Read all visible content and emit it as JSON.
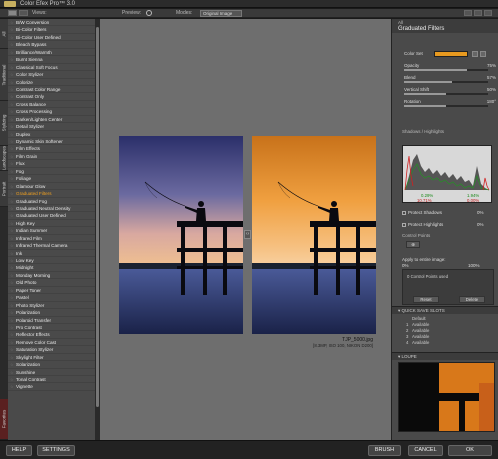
{
  "app": {
    "title": "Color Efex Pro™ 3.0"
  },
  "toolbar": {
    "views_label": "Views:",
    "preview_label": "Preview:",
    "modes_label": "Modes:",
    "mode_value": "Original Image"
  },
  "left_tabs": [
    "All",
    "Traditional",
    "Stylizing",
    "Landscapes",
    "Portrait",
    "Favorites"
  ],
  "filters": [
    "B/W Conversion",
    "Bi-Color Filters",
    "Bi-Color User Defined",
    "Bleach Bypass",
    "Brilliance/Warmth",
    "Burnt Sienna",
    "Classical Soft Focus",
    "Color Stylizer",
    "Colorize",
    "Contrast Color Range",
    "Contrast Only",
    "Cross Balance",
    "Cross Processing",
    "Darken/Lighten Center",
    "Detail Stylizer",
    "Duplex",
    "Dynamic Skin Softener",
    "Film Effects",
    "Film Grain",
    "Flux",
    "Fog",
    "Foliage",
    "Glamour Glow",
    "Graduated Filters",
    "Graduated Fog",
    "Graduated Neutral Density",
    "Graduated User Defined",
    "High Key",
    "Indian Summer",
    "Infrared Film",
    "Infrared Thermal Camera",
    "Ink",
    "Low Key",
    "Midnight",
    "Monday Morning",
    "Old Photo",
    "Paper Toner",
    "Pastel",
    "Photo Stylizer",
    "Polarization",
    "Polaroid Transfer",
    "Pro Contrast",
    "Reflector Effects",
    "Remove Color Cast",
    "Saturation Stylizer",
    "Skylight Filter",
    "Solarization",
    "Sunshine",
    "Tonal Contrast",
    "Vignette"
  ],
  "active_filter": "Graduated Filters",
  "canvas": {
    "file_name": "TJP_5000.jpg",
    "file_meta": "[8.3MP, ISO 100, NIKON D200]"
  },
  "panel": {
    "category": "All",
    "title": "Graduated Filters",
    "color_set_label": "Color Set",
    "controls": [
      {
        "label": "Opacity",
        "value": "75%",
        "fill": 0.75
      },
      {
        "label": "Blend",
        "value": "57%",
        "fill": 0.57
      },
      {
        "label": "Vertical Shift",
        "value": "50%",
        "fill": 0.5
      },
      {
        "label": "Rotation",
        "value": "180°",
        "fill": 0.5
      }
    ],
    "shadows_highlights": "Shadows / Highlights",
    "histo_left_green": "0.29%",
    "histo_left_red": "10.71%",
    "histo_right_green": "1.94%",
    "histo_right_red": "0.00%",
    "protect_shadows": "Protect Shadows",
    "protect_shadows_val": "0%",
    "protect_highlights": "Protect Highlights",
    "protect_highlights_val": "0%",
    "control_points": "Control Points",
    "apply_label": "Apply to entire image:",
    "apply_min": "0%",
    "apply_max": "100%",
    "cp_used": "0 Control Points used",
    "reset_btn": "Reset",
    "delete_btn": "Delete",
    "quick_save": "QUICK SAVE SLOTS",
    "slots": [
      {
        "num": "",
        "label": "Default"
      },
      {
        "num": "1",
        "label": "Available"
      },
      {
        "num": "2",
        "label": "Available"
      },
      {
        "num": "3",
        "label": "Available"
      },
      {
        "num": "4",
        "label": "Available"
      }
    ],
    "loupe": "LOUPE"
  },
  "bottom": {
    "help": "HELP",
    "settings": "SETTINGS",
    "brush": "BRUSH",
    "cancel": "CANCEL",
    "ok": "OK"
  },
  "colors": {
    "accent": "#f0a020",
    "gradient_color": "#e89a20"
  }
}
